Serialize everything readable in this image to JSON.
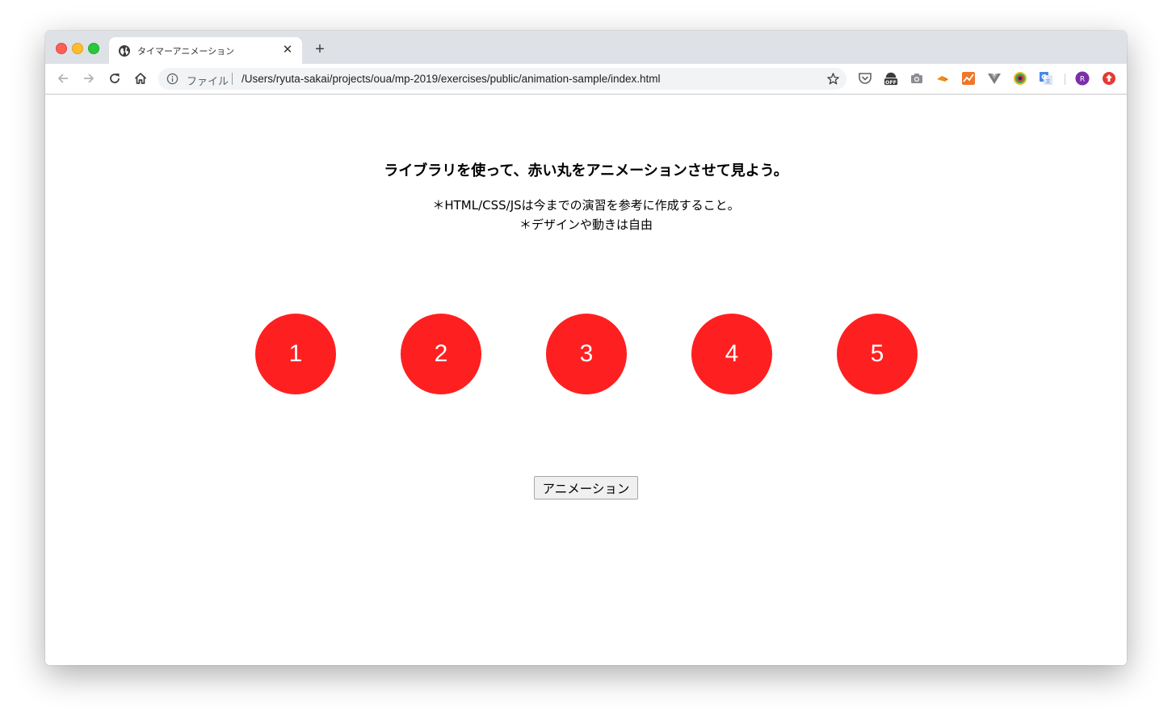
{
  "browser": {
    "tab": {
      "title": "タイマーアニメーション",
      "close_label": "✕"
    },
    "new_tab_label": "+",
    "address_bar": {
      "scheme_label": "ファイル",
      "url": "/Users/ryuta-sakai/projects/oua/mp-2019/exercises/public/animation-sample/index.html"
    },
    "extensions": [
      {
        "icon": "pocket-icon"
      },
      {
        "icon": "adblock-off-icon",
        "badge": "OFF"
      },
      {
        "icon": "camera-icon"
      },
      {
        "icon": "orange-extension-icon"
      },
      {
        "icon": "analytics-extension-icon"
      },
      {
        "icon": "vue-devtools-icon"
      },
      {
        "icon": "color-picker-icon"
      },
      {
        "icon": "google-translate-icon"
      }
    ],
    "profile_initial": "R",
    "colors": {
      "tabstrip": "#dee1e6",
      "omnibox": "#f1f3f4",
      "profile": "#7b2fa8",
      "update_badge": "#e53935"
    }
  },
  "page": {
    "heading": "ライブラリを使って、赤い丸をアニメーションさせて見よう。",
    "notes": [
      "＊HTML/CSS/JSは今までの演習を参考に作成すること。",
      "＊デザインや動きは自由"
    ],
    "circles": [
      "1",
      "2",
      "3",
      "4",
      "5"
    ],
    "circle_color": "#fe2020",
    "button_label": "アニメーション"
  }
}
